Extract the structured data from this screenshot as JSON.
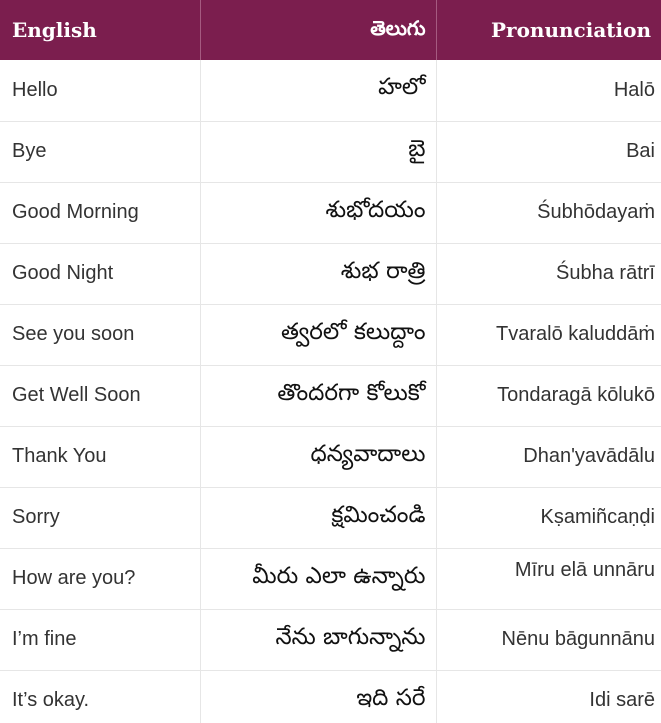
{
  "header": {
    "english": "English",
    "telugu": "తెలుగు",
    "pronunciation": "Pronunciation"
  },
  "rows": [
    {
      "english": "Hello",
      "telugu": "హలో",
      "pronunciation": "Halō"
    },
    {
      "english": "Bye",
      "telugu": "బై",
      "pronunciation": "Bai"
    },
    {
      "english": "Good Morning",
      "telugu": "శుభోదయం",
      "pronunciation": "Śubhōdayaṁ"
    },
    {
      "english": "Good Night",
      "telugu": "శుభ రాత్రి",
      "pronunciation": "Śubha rātrī"
    },
    {
      "english": "See you soon",
      "telugu": "త్వరలో కలుద్దాం",
      "pronunciation": "Tvaralō kaluddāṁ"
    },
    {
      "english": "Get Well Soon",
      "telugu": "తొందరగా కోలుకో",
      "pronunciation": "Tondaragā kōlukō"
    },
    {
      "english": "Thank You",
      "telugu": "ధన్యవాదాలు",
      "pronunciation": "Dhan'yavādālu"
    },
    {
      "english": "Sorry",
      "telugu": "క్షమించండి",
      "pronunciation": "Kṣamiñcaṇḍi"
    },
    {
      "english": "How are you?",
      "telugu": "మీరు ఎలా ఉన్నారు",
      "pronunciation": "Mīru elā unnāru"
    },
    {
      "english": "I’m fine",
      "telugu": "నేను బాగున్నాను",
      "pronunciation": "Nēnu bāgunnānu"
    },
    {
      "english": "It’s okay.",
      "telugu": "ఇది సరే",
      "pronunciation": "Idi sarē"
    }
  ]
}
